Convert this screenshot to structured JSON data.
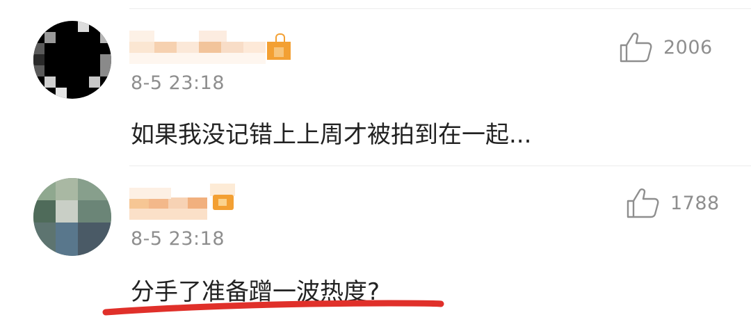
{
  "comments": [
    {
      "timestamp": "8-5 23:18",
      "text": "如果我没记错上上周才被拍到在一起...",
      "likes": "2006",
      "avatar_icon": "pixelated-avatar-icon",
      "like_icon": "thumbs-up-icon"
    },
    {
      "timestamp": "8-5 23:18",
      "text": "分手了准备蹭一波热度?",
      "likes": "1788",
      "avatar_icon": "pixelated-avatar-icon",
      "like_icon": "thumbs-up-icon"
    }
  ],
  "colors": {
    "text": "#222222",
    "meta": "#8e8e8e",
    "annotation": "#e0302a",
    "badge": "#f3a033"
  }
}
